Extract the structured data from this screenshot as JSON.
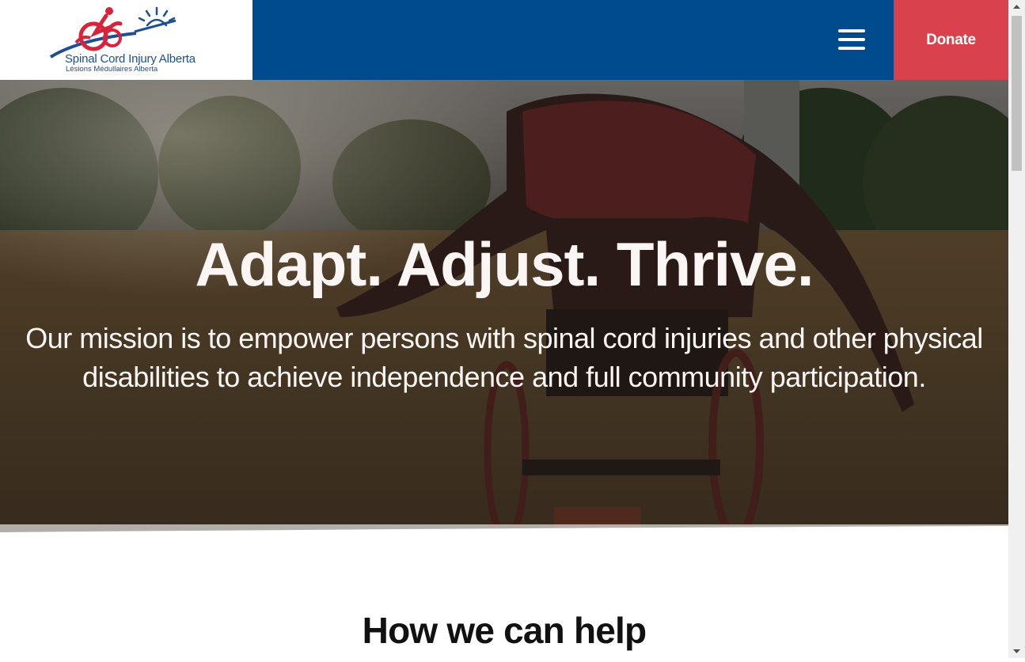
{
  "header": {
    "logo": {
      "name": "Spinal Cord Injury Alberta",
      "subtitle": "Lésions Médullaires Alberta"
    },
    "menu_icon": "hamburger-menu-icon",
    "donate_label": "Donate"
  },
  "hero": {
    "title": "Adapt. Adjust. Thrive.",
    "mission": "Our mission is to empower persons with spinal cord injuries and other physical disabilities to achieve independence and full community participation."
  },
  "section": {
    "title": "How we can help"
  },
  "colors": {
    "nav_blue": "#004b8d",
    "donate_red": "#d9414c",
    "logo_blue": "#1d4f91",
    "logo_red": "#d9233a"
  }
}
